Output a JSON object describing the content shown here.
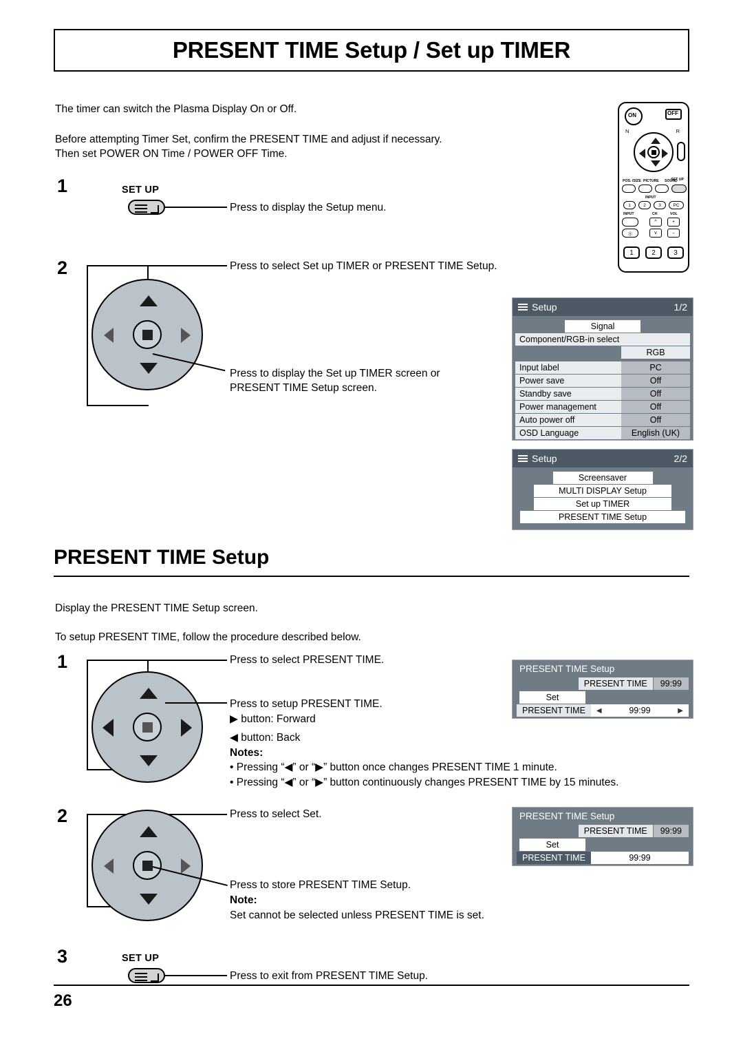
{
  "page": {
    "title": "PRESENT TIME Setup / Set up TIMER",
    "number": "26"
  },
  "intro": {
    "line1": "The timer can switch the Plasma Display On or Off.",
    "line2": "Before attempting Timer Set, confirm the PRESENT TIME and adjust if necessary.",
    "line3": "Then set POWER ON Time / POWER OFF Time."
  },
  "steps_top": [
    {
      "num": "1",
      "button_label": "SET UP",
      "text": "Press to display the Setup menu."
    },
    {
      "num": "2",
      "text_a": "Press to select Set up TIMER or PRESENT TIME Setup.",
      "text_b1": "Press to display the Set up TIMER screen or",
      "text_b2": "PRESENT TIME Setup screen."
    }
  ],
  "osd_setup_1": {
    "title": "Setup",
    "page": "1/2",
    "highlight": "Signal",
    "subrow": "Component/RGB-in select",
    "subvalue": "RGB",
    "rows": [
      {
        "label": "Input label",
        "value": "PC"
      },
      {
        "label": "Power save",
        "value": "Off"
      },
      {
        "label": "Standby save",
        "value": "Off"
      },
      {
        "label": "Power management",
        "value": "Off"
      },
      {
        "label": "Auto power off",
        "value": "Off"
      },
      {
        "label": "OSD Language",
        "value": "English (UK)"
      }
    ]
  },
  "osd_setup_2": {
    "title": "Setup",
    "page": "2/2",
    "items": [
      "Screensaver",
      "MULTI DISPLAY Setup",
      "Set up TIMER",
      "PRESENT TIME Setup"
    ]
  },
  "section": {
    "heading": "PRESENT TIME Setup",
    "line1": "Display the PRESENT TIME Setup screen.",
    "line2": "To setup PRESENT TIME, follow the procedure described below."
  },
  "steps_bottom": [
    {
      "num": "1",
      "t1": "Press to select PRESENT TIME.",
      "t2": "Press to setup PRESENT TIME.",
      "t3": "▶ button: Forward",
      "t4": "◀ button: Back",
      "notes_title": "Notes:",
      "note1": "• Pressing “◀” or “▶” button once changes PRESENT TIME 1 minute.",
      "note2": "• Pressing “◀” or “▶” button continuously changes PRESENT TIME by 15 minutes."
    },
    {
      "num": "2",
      "t1": "Press to select Set.",
      "t2": "Press to store PRESENT TIME Setup.",
      "note_title": "Note:",
      "note": "Set cannot be selected unless PRESENT TIME is set."
    },
    {
      "num": "3",
      "button_label": "SET UP",
      "t1": "Press to exit from PRESENT TIME Setup."
    }
  ],
  "osd_present_1": {
    "title": "PRESENT  TIME Setup",
    "row_label": "PRESENT  TIME",
    "row_value": "99:99",
    "set_label": "Set",
    "bottom_label": "PRESENT  TIME",
    "bottom_value": "99:99"
  },
  "osd_present_2": {
    "title": "PRESENT  TIME Setup",
    "row_label": "PRESENT  TIME",
    "row_value": "99:99",
    "set_label": "Set",
    "bottom_label": "PRESENT  TIME",
    "bottom_value": "99:99"
  },
  "remote": {
    "on": "ON",
    "off": "OFF",
    "n": "N",
    "r": "R",
    "pos_size": "POS. /SIZE",
    "picture": "PICTURE",
    "sound": "SOUND",
    "setup": "SET UP",
    "input": "INPUT",
    "num1": "1",
    "num2": "2",
    "num3": "3",
    "pc": "PC",
    "input_btn": "INPUT",
    "ch": "CH",
    "vol": "VOL",
    "plus": "+",
    "minus": "-",
    "b1": "1",
    "b2": "2",
    "b3": "3"
  },
  "colors": {
    "osd_bg": "#6f7b85",
    "osd_bar": "#4d5a66",
    "row_label_bg": "#e9ecef",
    "row_value_bg": "#b6bcc2",
    "pad_fill": "#b9c3c9"
  }
}
